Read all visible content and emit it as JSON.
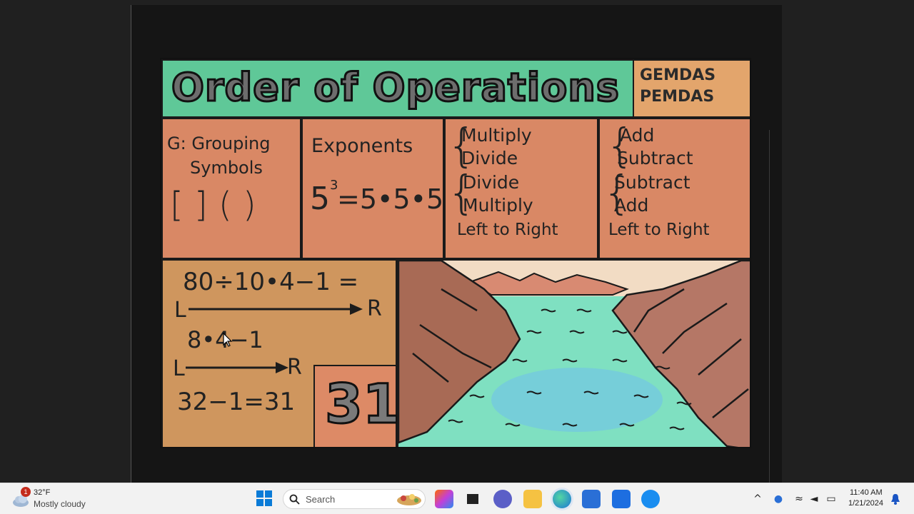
{
  "poster": {
    "title": "Order of Operations",
    "acronyms": [
      "GEMDAS",
      "PEMDAS"
    ],
    "grouping": {
      "label_line1": "G: Grouping",
      "label_line2": "Symbols",
      "symbols": "[ ] ( )"
    },
    "exponents": {
      "label": "Exponents",
      "base": "5",
      "power": "3",
      "expansion": "=5•5•5"
    },
    "multiply_divide": {
      "line1": "Multiply",
      "line2": "Divide",
      "line3": "Divide",
      "line4": "Multiply",
      "direction": "Left to Right"
    },
    "add_subtract": {
      "line1": "Add",
      "line2": "Subtract",
      "line3": "Subtract",
      "line4": "Add",
      "direction": "Left to Right"
    },
    "example": {
      "expression": "80÷10•4−1 =",
      "left": "L",
      "right": "R",
      "step2": "8•4−1",
      "step3": "32−1=31",
      "answer": "31"
    }
  },
  "taskbar": {
    "weather_temp": "32°F",
    "weather_desc": "Mostly cloudy",
    "weather_badge": "1",
    "search_placeholder": "Search",
    "time": "11:40 AM",
    "date": "1/21/2024"
  }
}
